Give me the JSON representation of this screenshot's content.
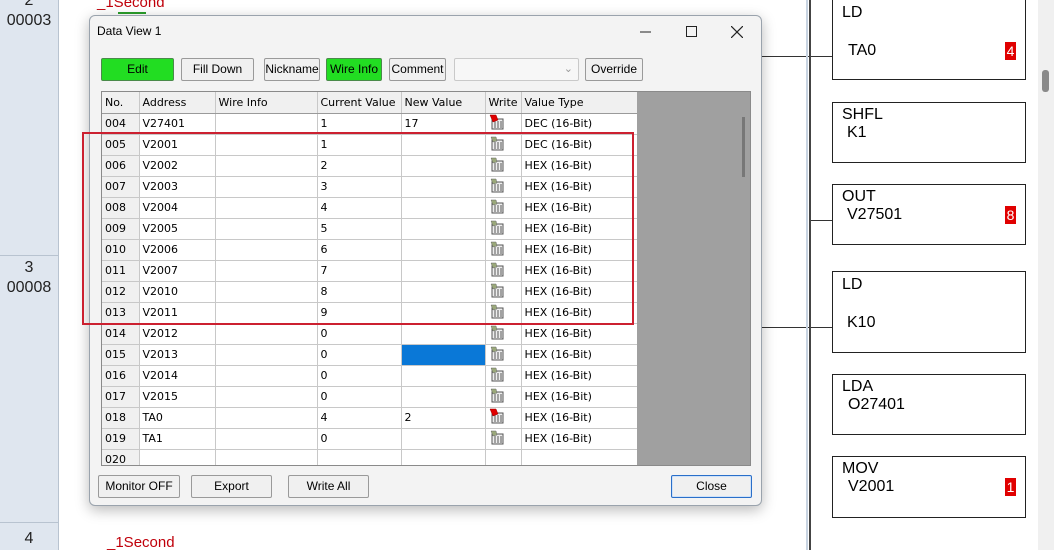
{
  "background": {
    "rungs": [
      {
        "num": "2",
        "addr": "00003"
      },
      {
        "num": "3",
        "addr": "00008"
      },
      {
        "num": "4",
        "addr": ""
      }
    ],
    "top_text": "_1Second",
    "bottom_text": "_1Second",
    "instructions": [
      {
        "op": "LD",
        "arg": "TA0",
        "badge": "4"
      },
      {
        "op": "SHFL",
        "arg": "K1",
        "badge": ""
      },
      {
        "op": "OUT",
        "arg": "V27501",
        "badge": "8"
      },
      {
        "op": "LD",
        "arg": "K10",
        "badge": ""
      },
      {
        "op": "LDA",
        "arg": "O27401",
        "badge": ""
      },
      {
        "op": "MOV",
        "arg": "V2001",
        "badge": "1"
      }
    ]
  },
  "dialog": {
    "title": "Data View 1",
    "toolbar": {
      "edit": "Edit",
      "fill_down": "Fill Down",
      "nickname": "Nickname",
      "wire_info": "Wire Info",
      "comment": "Comment",
      "combo_value": "",
      "override": "Override"
    },
    "columns": [
      "No.",
      "Address",
      "Wire Info",
      "Current Value",
      "New Value",
      "Write",
      "Value Type"
    ],
    "rows": [
      {
        "no": "004",
        "address": "V27401",
        "wire": "",
        "current": "1",
        "new": "17",
        "write": "armed",
        "type": "DEC (16-Bit)"
      },
      {
        "no": "005",
        "address": "V2001",
        "wire": "",
        "current": "1",
        "new": "",
        "write": "idle",
        "type": "DEC (16-Bit)"
      },
      {
        "no": "006",
        "address": "V2002",
        "wire": "",
        "current": "2",
        "new": "",
        "write": "idle",
        "type": "HEX (16-Bit)"
      },
      {
        "no": "007",
        "address": "V2003",
        "wire": "",
        "current": "3",
        "new": "",
        "write": "idle",
        "type": "HEX (16-Bit)"
      },
      {
        "no": "008",
        "address": "V2004",
        "wire": "",
        "current": "4",
        "new": "",
        "write": "idle",
        "type": "HEX (16-Bit)"
      },
      {
        "no": "009",
        "address": "V2005",
        "wire": "",
        "current": "5",
        "new": "",
        "write": "idle",
        "type": "HEX (16-Bit)"
      },
      {
        "no": "010",
        "address": "V2006",
        "wire": "",
        "current": "6",
        "new": "",
        "write": "idle",
        "type": "HEX (16-Bit)"
      },
      {
        "no": "011",
        "address": "V2007",
        "wire": "",
        "current": "7",
        "new": "",
        "write": "idle",
        "type": "HEX (16-Bit)"
      },
      {
        "no": "012",
        "address": "V2010",
        "wire": "",
        "current": "8",
        "new": "",
        "write": "idle",
        "type": "HEX (16-Bit)"
      },
      {
        "no": "013",
        "address": "V2011",
        "wire": "",
        "current": "9",
        "new": "",
        "write": "idle",
        "type": "HEX (16-Bit)"
      },
      {
        "no": "014",
        "address": "V2012",
        "wire": "",
        "current": "0",
        "new": "",
        "write": "idle",
        "type": "HEX (16-Bit)"
      },
      {
        "no": "015",
        "address": "V2013",
        "wire": "",
        "current": "0",
        "new": "",
        "write": "idle",
        "type": "HEX (16-Bit)",
        "selected_new": true
      },
      {
        "no": "016",
        "address": "V2014",
        "wire": "",
        "current": "0",
        "new": "",
        "write": "idle",
        "type": "HEX (16-Bit)"
      },
      {
        "no": "017",
        "address": "V2015",
        "wire": "",
        "current": "0",
        "new": "",
        "write": "idle",
        "type": "HEX (16-Bit)"
      },
      {
        "no": "018",
        "address": "TA0",
        "wire": "",
        "current": "4",
        "new": "2",
        "write": "armed",
        "type": "HEX (16-Bit)"
      },
      {
        "no": "019",
        "address": "TA1",
        "wire": "",
        "current": "0",
        "new": "",
        "write": "idle",
        "type": "HEX (16-Bit)"
      },
      {
        "no": "020",
        "address": "",
        "wire": "",
        "current": "",
        "new": "",
        "write": "none",
        "type": ""
      }
    ],
    "buttons": {
      "monitor_off": "Monitor OFF",
      "export": "Export",
      "write_all": "Write All",
      "close": "Close"
    }
  },
  "colors": {
    "green_button": "#22dd22",
    "highlight_border": "#cc2030",
    "selection": "#0a78d7",
    "badge": "#e00000",
    "ladder_text": "#c0000a"
  }
}
